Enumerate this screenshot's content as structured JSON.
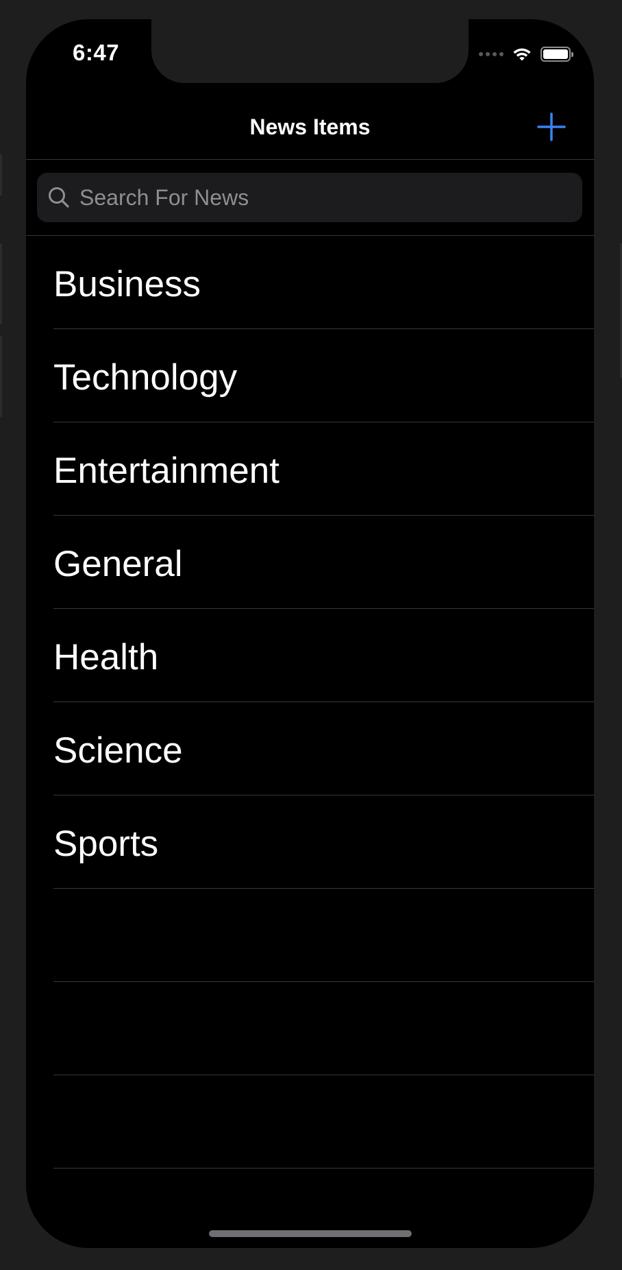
{
  "status_bar": {
    "time": "6:47",
    "icons": [
      "cellular-signal-icon",
      "wifi-icon",
      "battery-icon"
    ]
  },
  "nav_bar": {
    "title": "News Items",
    "add_icon": "plus-icon"
  },
  "search": {
    "placeholder": "Search For News",
    "value": "",
    "icon": "search-icon"
  },
  "categories": {
    "items": [
      {
        "label": "Business"
      },
      {
        "label": "Technology"
      },
      {
        "label": "Entertainment"
      },
      {
        "label": "General"
      },
      {
        "label": "Health"
      },
      {
        "label": "Science"
      },
      {
        "label": "Sports"
      }
    ]
  },
  "colors": {
    "background": "#000000",
    "frame": "#1e1e1f",
    "accent": "#3b82f6",
    "text": "#ffffff",
    "placeholder": "#8e8e93",
    "separator": "#38383a"
  }
}
